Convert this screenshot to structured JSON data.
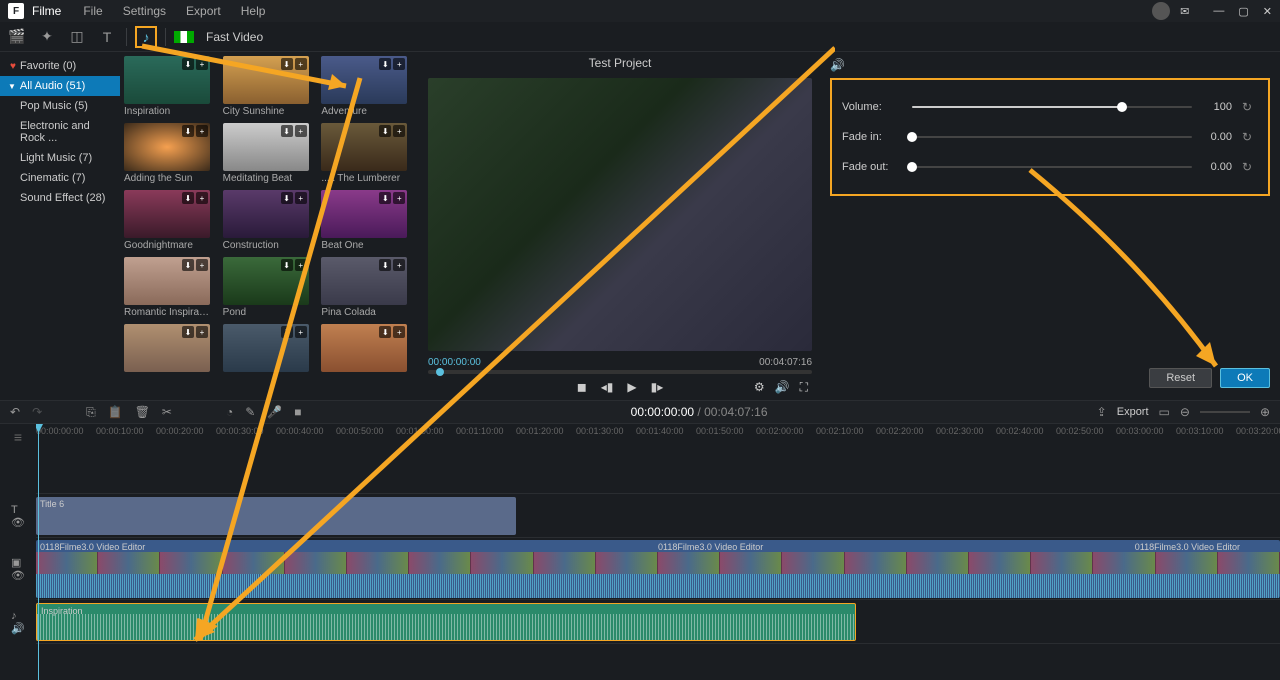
{
  "app": {
    "name": "Filme"
  },
  "menu": [
    "File",
    "Settings",
    "Export",
    "Help"
  ],
  "toolbar": {
    "fast_video": "Fast Video"
  },
  "sidebar": {
    "favorite": "Favorite (0)",
    "categories": [
      {
        "label": "All Audio (51)",
        "selected": true
      },
      {
        "label": "Pop Music (5)"
      },
      {
        "label": "Electronic and Rock ..."
      },
      {
        "label": "Light Music (7)"
      },
      {
        "label": "Cinematic (7)"
      },
      {
        "label": "Sound Effect (28)"
      }
    ]
  },
  "grid": [
    {
      "label": "Inspiration",
      "bg": "linear-gradient(#2a6a5a,#1a4a3a)"
    },
    {
      "label": "City Sunshine",
      "bg": "linear-gradient(#d4a050,#8a6030)"
    },
    {
      "label": "Adventure",
      "bg": "linear-gradient(#4a5a8a,#2a3a5a)"
    },
    {
      "label": "Adding the Sun",
      "bg": "radial-gradient(#f5a050,#3a2a1a)"
    },
    {
      "label": "Meditating Beat",
      "bg": "linear-gradient(#ccc,#888)"
    },
    {
      "label": "...k The Lumberer",
      "bg": "linear-gradient(#6a5a3a,#3a2a1a)"
    },
    {
      "label": "Goodnightmare",
      "bg": "linear-gradient(#8a3a5a,#3a1a2a)"
    },
    {
      "label": "Construction",
      "bg": "linear-gradient(#5a3a6a,#2a1a3a)"
    },
    {
      "label": "Beat One",
      "bg": "linear-gradient(#8a3a8a,#4a1a5a)"
    },
    {
      "label": "Romantic Inspiration",
      "bg": "linear-gradient(#c0a090,#8a6a5a)"
    },
    {
      "label": "Pond",
      "bg": "linear-gradient(#3a6a3a,#1a3a1a)"
    },
    {
      "label": "Pina Colada",
      "bg": "linear-gradient(#5a5a6a,#3a3a4a)"
    },
    {
      "label": "",
      "bg": "linear-gradient(#b09070,#7a6050)"
    },
    {
      "label": "",
      "bg": "linear-gradient(#4a5a6a,#2a3a4a)"
    },
    {
      "label": "",
      "bg": "linear-gradient(#c08050,#8a5030)"
    }
  ],
  "preview": {
    "title": "Test Project",
    "time_current": "00:00:00:00",
    "time_total": "00:04:07:16"
  },
  "props": {
    "volume": {
      "label": "Volume:",
      "value": "100",
      "pct": 75
    },
    "fadein": {
      "label": "Fade in:",
      "value": "0.00",
      "pct": 0
    },
    "fadeout": {
      "label": "Fade out:",
      "value": "0.00",
      "pct": 0
    },
    "reset": "Reset",
    "ok": "OK"
  },
  "tltoolbar": {
    "current": "00:00:00:00",
    "total": "00:04:07:16",
    "export": "Export"
  },
  "ruler": [
    "00:00:00:00",
    "00:00:10:00",
    "00:00:20:00",
    "00:00:30:00",
    "00:00:40:00",
    "00:00:50:00",
    "00:01:00:00",
    "00:01:10:00",
    "00:01:20:00",
    "00:01:30:00",
    "00:01:40:00",
    "00:01:50:00",
    "00:02:00:00",
    "00:02:10:00",
    "00:02:20:00",
    "00:02:30:00",
    "00:02:40:00",
    "00:02:50:00",
    "00:03:00:00",
    "00:03:10:00",
    "00:03:20:00"
  ],
  "clips": {
    "title": "Title 6",
    "video": "0118Filme3.0 Video Editor",
    "video2": "0118Filme3.0 Video Editor",
    "audio": "Inspiration"
  }
}
